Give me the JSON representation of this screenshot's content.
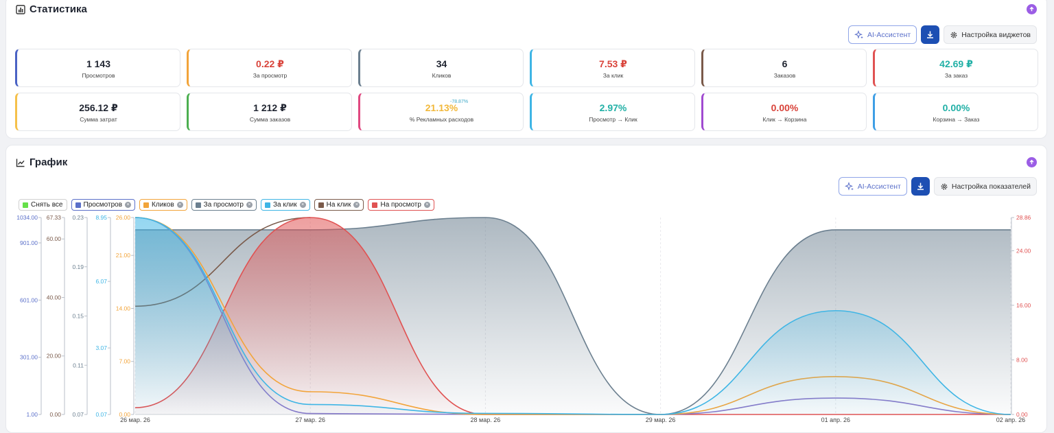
{
  "stats": {
    "title": "Статистика",
    "ai_label": "AI-Ассистент",
    "settings_label": "Настройка виджетов",
    "cards": [
      {
        "value": "1 143",
        "label": "Просмотров",
        "color": "#1f2430",
        "accent": "#4a62c4"
      },
      {
        "value": "0.22 ₽",
        "label": "За просмотр",
        "color": "#d9433a",
        "accent": "#f2a43a"
      },
      {
        "value": "34",
        "label": "Кликов",
        "color": "#1f2430",
        "accent": "#6b7f8f"
      },
      {
        "value": "7.53 ₽",
        "label": "За клик",
        "color": "#d9433a",
        "accent": "#3eb5e5"
      },
      {
        "value": "6",
        "label": "Заказов",
        "color": "#1f2430",
        "accent": "#7a5a4a"
      },
      {
        "value": "42.69 ₽",
        "label": "За заказ",
        "color": "#21b0a6",
        "accent": "#e05252"
      },
      {
        "value": "256.12 ₽",
        "label": "Сумма затрат",
        "color": "#1f2430",
        "accent": "#f5c04a"
      },
      {
        "value": "1 212 ₽",
        "label": "Сумма заказов",
        "color": "#1f2430",
        "accent": "#4caf50"
      },
      {
        "value": "21.13%",
        "label": "% Рекламных расходов",
        "color": "#f2b83a",
        "accent": "#e04880",
        "delta": "-78.87%"
      },
      {
        "value": "2.97%",
        "label": "Просмотр → Клик",
        "color": "#21b0a6",
        "accent": "#3eb5e5"
      },
      {
        "value": "0.00%",
        "label": "Клик → Корзина",
        "color": "#d9433a",
        "accent": "#a04ad0"
      },
      {
        "value": "0.00%",
        "label": "Корзина → Заказ",
        "color": "#21b0a6",
        "accent": "#3e9ee5"
      }
    ]
  },
  "graph": {
    "title": "График",
    "ai_label": "AI-Ассистент",
    "settings_label": "Настройка показателей",
    "legend": [
      {
        "label": "Снять все",
        "color": "#66e04a",
        "border": "#d0d0d0",
        "closable": false
      },
      {
        "label": "Просмотров",
        "color": "#5a6fc9",
        "border": "#5a6fc9",
        "closable": true
      },
      {
        "label": "Кликов",
        "color": "#f2a43a",
        "border": "#f2a43a",
        "closable": true
      },
      {
        "label": "За просмотр",
        "color": "#6b7f8f",
        "border": "#6b7f8f",
        "closable": true
      },
      {
        "label": "За клик",
        "color": "#3eb5e5",
        "border": "#3eb5e5",
        "closable": true
      },
      {
        "label": "На клик",
        "color": "#7a5a4a",
        "border": "#7a5a4a",
        "closable": true
      },
      {
        "label": "На просмотр",
        "color": "#e05252",
        "border": "#e05252",
        "closable": true
      }
    ]
  },
  "chart_data": {
    "type": "line",
    "categories": [
      "26 мар. 26",
      "27 мар. 26",
      "28 мар. 26",
      "29 мар. 26",
      "01 апр. 26",
      "02 апр. 26"
    ],
    "axes": [
      {
        "ticks": [
          "1034.00",
          "901.00",
          "601.00",
          "301.00",
          "1.00"
        ],
        "tick_values": [
          1034,
          901,
          601,
          301,
          1
        ],
        "range": [
          1,
          1034
        ],
        "color": "#5a6fc9"
      },
      {
        "ticks": [
          "67.33",
          "60.00",
          "40.00",
          "20.00",
          "0.00"
        ],
        "tick_values": [
          67.33,
          60,
          40,
          20,
          0
        ],
        "range": [
          0,
          67.33
        ],
        "color": "#7a5a4a"
      },
      {
        "ticks": [
          "0.23",
          "0.19",
          "0.15",
          "0.11",
          "0.07"
        ],
        "tick_values": [
          0.23,
          0.19,
          0.15,
          0.11,
          0.07
        ],
        "range": [
          0.07,
          0.23
        ],
        "color": "#6b7f8f"
      },
      {
        "ticks": [
          "8.95",
          "6.07",
          "3.07",
          "0.07"
        ],
        "tick_values": [
          8.95,
          6.07,
          3.07,
          0.07
        ],
        "range": [
          0.07,
          8.95
        ],
        "color": "#3eb5e5"
      },
      {
        "ticks": [
          "26.00",
          "21.00",
          "14.00",
          "7.00",
          "0.00"
        ],
        "tick_values": [
          26,
          21,
          14,
          7,
          0
        ],
        "range": [
          0,
          26
        ],
        "color": "#f2a43a"
      },
      {
        "ticks": [
          "28.86",
          "24.00",
          "16.00",
          "8.00",
          "0.00"
        ],
        "tick_values": [
          28.86,
          24,
          16,
          8,
          0
        ],
        "range": [
          0,
          28.86
        ],
        "color": "#e05252",
        "side": "right"
      }
    ],
    "series": [
      {
        "name": "За просмотр",
        "axis": 2,
        "color": "#6b7f8f",
        "fill": true,
        "values": [
          0.22,
          0.22,
          0.23,
          0.07,
          0.22,
          0.22
        ]
      },
      {
        "name": "На клик",
        "axis": 1,
        "color": "#7a5a4a",
        "fill": false,
        "values": [
          37,
          67.33,
          null,
          null,
          null,
          null
        ]
      },
      {
        "name": "На просмотр",
        "axis": 5,
        "color": "#e05252",
        "fill": true,
        "values": [
          1,
          28.86,
          0,
          0,
          0,
          0
        ]
      },
      {
        "name": "Просмотров",
        "axis": 0,
        "color": "#8878c8",
        "fill": false,
        "values": [
          1034,
          6,
          1,
          1,
          87,
          1
        ]
      },
      {
        "name": "Кликов",
        "axis": 4,
        "color": "#f2a43a",
        "fill": false,
        "values": [
          26,
          3,
          0,
          0,
          5,
          0
        ]
      },
      {
        "name": "За клик",
        "axis": 3,
        "color": "#3eb5e5",
        "fill": true,
        "values": [
          8.95,
          0.52,
          0.12,
          0.07,
          4.75,
          0.07
        ]
      }
    ],
    "grid": true
  }
}
